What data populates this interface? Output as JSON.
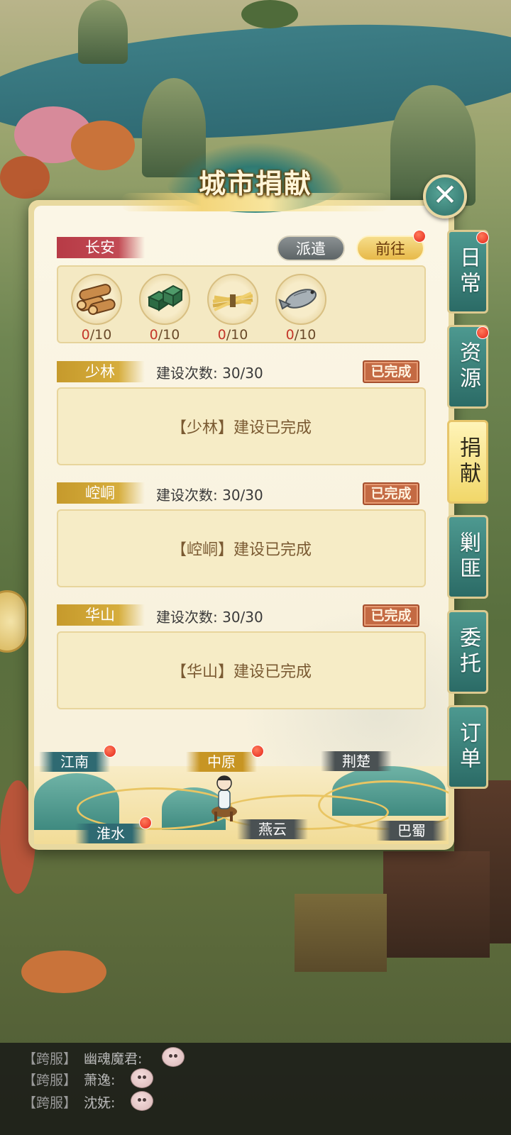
{
  "title": "城市捐献",
  "close_icon": "close-icon",
  "city": {
    "name": "长安",
    "dispatch_label": "派遣",
    "goto_label": "前往",
    "resources": [
      {
        "icon": "wood-logs-icon",
        "current": "0",
        "total": "/10"
      },
      {
        "icon": "jade-stones-icon",
        "current": "0",
        "total": "/10"
      },
      {
        "icon": "grain-bundle-icon",
        "current": "0",
        "total": "/10"
      },
      {
        "icon": "fish-icon",
        "current": "0",
        "total": "/10"
      }
    ]
  },
  "buildings": [
    {
      "name": "少林",
      "count_label": "建设次数:",
      "count": "30/30",
      "stamp": "已完成",
      "message": "【少林】建设已完成"
    },
    {
      "name": "崆峒",
      "count_label": "建设次数:",
      "count": "30/30",
      "stamp": "已完成",
      "message": "【崆峒】建设已完成"
    },
    {
      "name": "华山",
      "count_label": "建设次数:",
      "count": "30/30",
      "stamp": "已完成",
      "message": "【华山】建设已完成"
    }
  ],
  "regions": [
    "江南",
    "中原",
    "荆楚",
    "淮水",
    "燕云",
    "巴蜀"
  ],
  "side_tabs": [
    {
      "label": "日常",
      "badge": true
    },
    {
      "label": "资源",
      "badge": true
    },
    {
      "label": "捐献",
      "active": true
    },
    {
      "label": "剿匪"
    },
    {
      "label": "委托"
    },
    {
      "label": "订单"
    }
  ],
  "chat": [
    {
      "channel": "【跨服】",
      "user": "幽魂魔君:"
    },
    {
      "channel": "【跨服】",
      "user": "萧逸:"
    },
    {
      "channel": "【跨服】",
      "user": "沈妩:"
    }
  ],
  "colors": {
    "accent_red": "#b73b46",
    "accent_gold": "#c69a2c",
    "teal": "#2b6b66",
    "stamp": "#c46a43"
  }
}
